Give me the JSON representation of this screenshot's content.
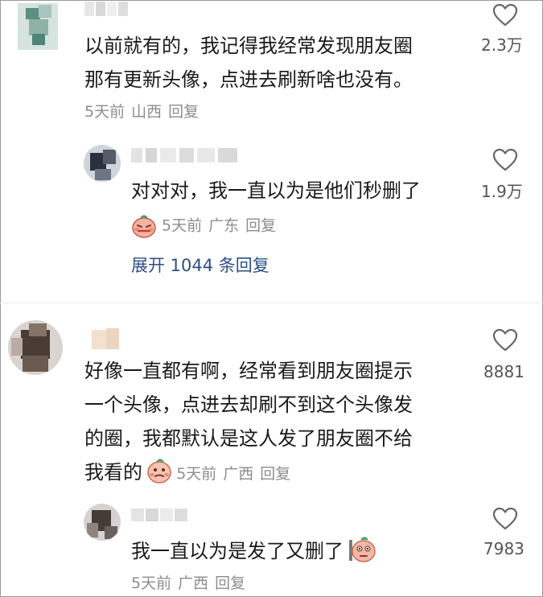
{
  "comments": [
    {
      "text_lines": [
        "以前就有的，我记得我经常发现朋友圈",
        "那有更新头像，点进去刷新啥也没有。"
      ],
      "time": "5天前",
      "location": "山西",
      "reply_label": "回复",
      "likes": "2.3万",
      "replies": [
        {
          "text_lines": [
            "对对对，我一直以为是他们秒删了"
          ],
          "time": "5天前",
          "location": "广东",
          "reply_label": "回复",
          "likes": "1.9万"
        }
      ],
      "expand_label": "展开 1044 条回复"
    },
    {
      "text_lines": [
        "好像一直都有啊，经常看到朋友圈提示",
        "一个头像，点进去却刷不到这个头像发",
        "的圈，我都默认是这人发了朋友圈不给",
        "我看的"
      ],
      "time": "5天前",
      "location": "广西",
      "reply_label": "回复",
      "likes": "8881",
      "replies": [
        {
          "text_lines": [
            "我一直以为是发了又删了"
          ],
          "time": "5天前",
          "location": "广西",
          "reply_label": "回复",
          "likes": "7983"
        }
      ]
    }
  ],
  "colors": {
    "text": "#1a1a1a",
    "meta": "#8d8d8d",
    "link": "#2d4f86",
    "like_icon": "#666666"
  },
  "icons": [
    "heart-outline-icon",
    "blush-face-emoji",
    "peek-face-emoji"
  ]
}
